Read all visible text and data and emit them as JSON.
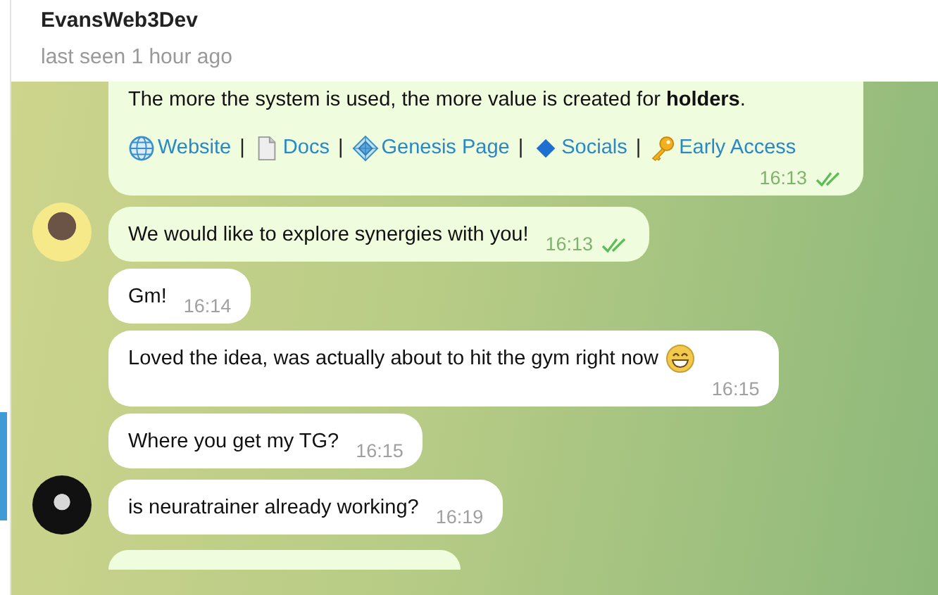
{
  "header": {
    "name": "EvansWeb3Dev",
    "status": "last seen 1 hour ago"
  },
  "link_separator": "|",
  "messages": [
    {
      "kind": "outgoing",
      "text": "The more the system is used, the more value is created for **holders**.",
      "links": [
        {
          "label": "Website"
        },
        {
          "label": "Docs"
        },
        {
          "label": "Genesis Page"
        },
        {
          "label": "Socials"
        },
        {
          "label": "Early Access"
        }
      ],
      "time": "16:13",
      "read": true
    },
    {
      "kind": "outgoing",
      "text": "We would like to explore synergies with you!",
      "time": "16:13",
      "read": true,
      "avatar": true
    },
    {
      "kind": "incoming",
      "text": "Gm!",
      "time": "16:14"
    },
    {
      "kind": "incoming",
      "text": "Loved the idea, was actually about to hit the gym right now",
      "emoji": true,
      "time": "16:15"
    },
    {
      "kind": "incoming",
      "text": "Where you get my TG?",
      "time": "16:15"
    },
    {
      "kind": "incoming",
      "text": "is neuratrainer already working?",
      "time": "16:19",
      "avatar": true
    },
    {
      "kind": "outgoing_partial"
    }
  ]
}
